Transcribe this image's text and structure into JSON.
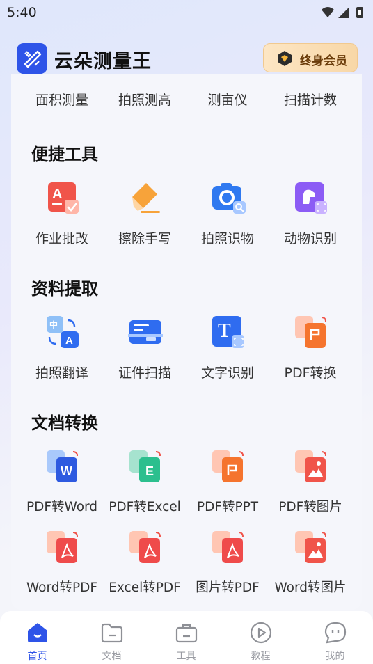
{
  "status_bar": {
    "time": "5:40"
  },
  "header": {
    "app_name": "云朵测量王",
    "member_label": "终身会员"
  },
  "top_row": [
    {
      "label": "面积测量",
      "icon": "area-measure-icon"
    },
    {
      "label": "拍照测高",
      "icon": "photo-height-icon"
    },
    {
      "label": "测亩仪",
      "icon": "mu-meter-icon"
    },
    {
      "label": "扫描计数",
      "icon": "scan-count-icon"
    }
  ],
  "sections": [
    {
      "title": "便捷工具",
      "items": [
        {
          "label": "作业批改",
          "icon": "homework-check-icon"
        },
        {
          "label": "擦除手写",
          "icon": "eraser-icon"
        },
        {
          "label": "拍照识物",
          "icon": "camera-recognize-icon"
        },
        {
          "label": "动物识别",
          "icon": "animal-recognize-icon"
        }
      ]
    },
    {
      "title": "资料提取",
      "items": [
        {
          "label": "拍照翻译",
          "icon": "translate-icon"
        },
        {
          "label": "证件扫描",
          "icon": "id-scan-icon"
        },
        {
          "label": "文字识别",
          "icon": "text-ocr-icon"
        },
        {
          "label": "PDF转换",
          "icon": "pdf-convert-icon"
        }
      ]
    },
    {
      "title": "文档转换",
      "items": [
        {
          "label": "PDF转Word",
          "icon": "pdf-to-word-icon"
        },
        {
          "label": "PDF转Excel",
          "icon": "pdf-to-excel-icon"
        },
        {
          "label": "PDF转PPT",
          "icon": "pdf-to-ppt-icon"
        },
        {
          "label": "PDF转图片",
          "icon": "pdf-to-image-icon"
        },
        {
          "label": "Word转PDF",
          "icon": "word-to-pdf-icon"
        },
        {
          "label": "Excel转PDF",
          "icon": "excel-to-pdf-icon"
        },
        {
          "label": "图片转PDF",
          "icon": "image-to-pdf-icon"
        },
        {
          "label": "Word转图片",
          "icon": "word-to-image-icon"
        }
      ]
    }
  ],
  "tab_bar": [
    {
      "label": "首页",
      "icon": "home-icon",
      "active": true
    },
    {
      "label": "文档",
      "icon": "folder-icon",
      "active": false
    },
    {
      "label": "工具",
      "icon": "toolbox-icon",
      "active": false
    },
    {
      "label": "教程",
      "icon": "play-icon",
      "active": false
    },
    {
      "label": "我的",
      "icon": "profile-chat-icon",
      "active": false
    }
  ],
  "colors": {
    "brand": "#2e54e8",
    "member_text": "#6a3b09",
    "pdf_red": "#ef4b4b",
    "word_blue": "#2e5ae0"
  }
}
